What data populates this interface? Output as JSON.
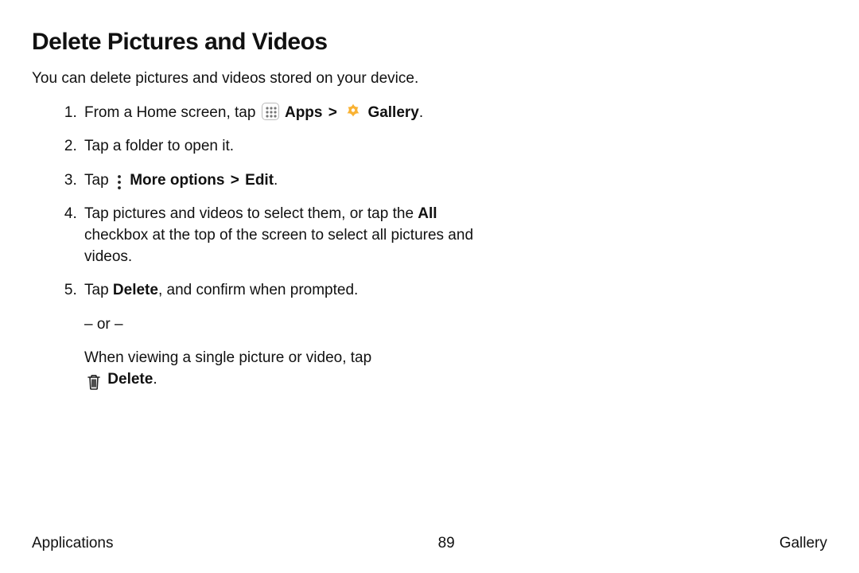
{
  "title": "Delete Pictures and Videos",
  "intro": "You can delete pictures and videos stored on your device.",
  "steps": {
    "s1_pre": "From a Home screen, tap ",
    "s1_apps": "Apps",
    "s1_gallery": "Gallery",
    "s1_period": ".",
    "s2": "Tap a folder to open it.",
    "s3_pre": "Tap ",
    "s3_more": "More options",
    "s3_edit": "Edit",
    "s3_period": ".",
    "s4_a": "Tap pictures and videos to select them, or tap the ",
    "s4_all": "All",
    "s4_b": " checkbox at the top of the screen to select all pictures and videos.",
    "s5_a": "Tap ",
    "s5_delete": "Delete",
    "s5_b": ", and confirm when prompted.",
    "s5_or": "– or –",
    "s5_c": "When viewing a single picture or video, tap ",
    "s5_delete2": "Delete",
    "s5_period": "."
  },
  "chevron": ">",
  "footer": {
    "left": "Applications",
    "page": "89",
    "right": "Gallery"
  }
}
